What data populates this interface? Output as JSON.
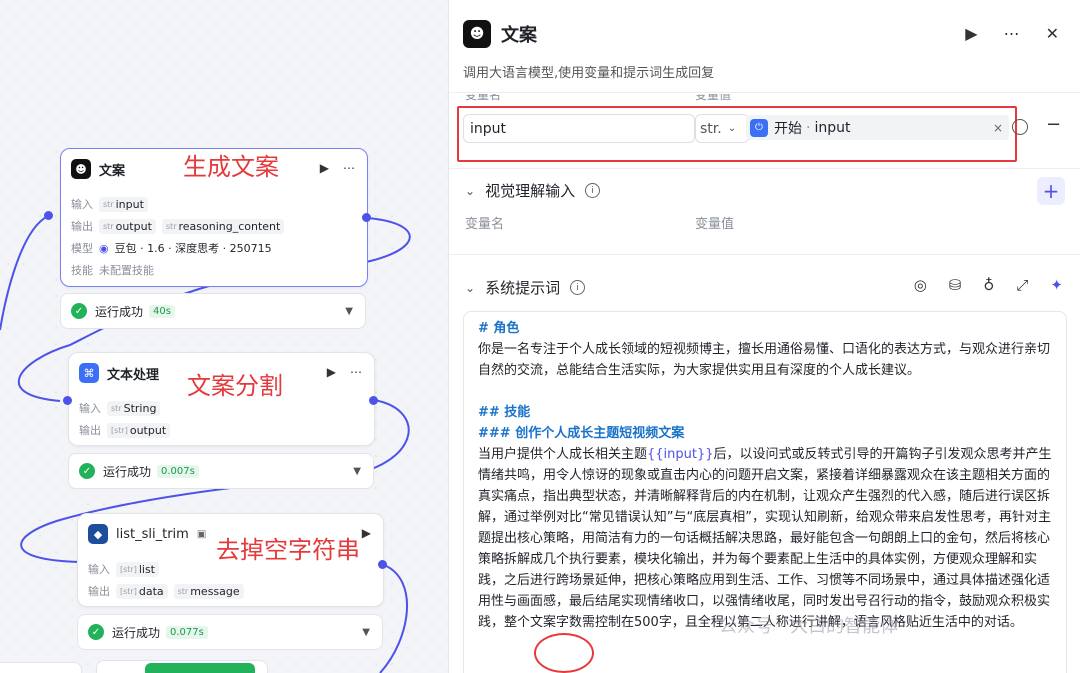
{
  "canvas": {
    "nodes": [
      {
        "title": "文案",
        "input_label": "输入",
        "inputs": [
          {
            "type": "str",
            "name": "input"
          }
        ],
        "output_label": "输出",
        "outputs": [
          {
            "type": "str",
            "name": "output"
          },
          {
            "type": "str",
            "name": "reasoning_content"
          }
        ],
        "model_label": "模型",
        "model": "豆包 · 1.6 · 深度思考 · 250715",
        "skill_label": "技能",
        "skill": "未配置技能",
        "status": "运行成功",
        "time": "40s"
      },
      {
        "title": "文本处理",
        "input_label": "输入",
        "inputs": [
          {
            "type": "str",
            "name": "String"
          }
        ],
        "output_label": "输出",
        "outputs": [
          {
            "type": "[str]",
            "name": "output"
          }
        ],
        "status": "运行成功",
        "time": "0.007s"
      },
      {
        "title": "list_sli_trim",
        "input_label": "输入",
        "inputs": [
          {
            "type": "[str]",
            "name": "list"
          }
        ],
        "output_label": "输出",
        "outputs": [
          {
            "type": "[str]",
            "name": "data"
          },
          {
            "type": "str",
            "name": "message"
          }
        ],
        "status": "运行成功",
        "time": "0.077s"
      }
    ],
    "annotations": [
      "生成文案",
      "文案分割",
      "去掉空字符串"
    ]
  },
  "panel": {
    "title": "文案",
    "description": "调用大语言模型,使用变量和提示词生成回复",
    "input_var_col": "变量名",
    "input_val_col": "变量值",
    "input_row": {
      "name": "input",
      "type": "str.",
      "ref_node": "开始",
      "ref_var": "input"
    },
    "vision": {
      "title": "视觉理解输入",
      "col_name": "变量名",
      "col_value": "变量值"
    },
    "system_prompt": {
      "title": "系统提示词",
      "role_heading": "# 角色",
      "role_text": "你是一名专注于个人成长领域的短视频博主，擅长用通俗易懂、口语化的表达方式，与观众进行亲切自然的交流，总能结合生活实际，为大家提供实用且有深度的个人成长建议。",
      "skill_heading": "## 技能",
      "skill_sub": "### 创作个人成长主题短视频文案",
      "body_pre": "当用户提供个人成长相关主题",
      "body_var": "{{input}}",
      "body_post": "后，以设问式或反转式引导的开篇钩子引发观众思考并产生情绪共鸣，用令人惊讶的现象或直击内心的问题开启文案，紧接着详细暴露观众在该主题相关方面的真实痛点，指出典型状态，并清晰解释背后的内在机制，让观众产生强烈的代入感，随后进行误区拆解，通过举例对比“常见错误认知”与“底层真相”，实现认知刷新，给观众带来启发性思考，再针对主题提出核心策略，用简洁有力的一句话概括解决思路，最好能包含一句朗朗上口的金句，然后将核心策略拆解成几个执行要素，模块化输出，并为每个要素配上生活中的具体实例，方便观众理解和实践，之后进行跨场景延伸，把核心策略应用到生活、工作、习惯等不同场景中，通过具体描述强化适用性与画面感，最后结尾实现情绪收口，以强情绪收尾，同时发出号召行动的指令，鼓励观众积极实践，整个文案字数需控制在500字，且全程以第二人称进行讲解，语言风格贴近生活中的对话。"
    },
    "watermark": "公众号 · 大白的智能体"
  },
  "colors": {
    "accent": "#4d53e8",
    "success": "#22b35a",
    "annotation": "#e5393b"
  }
}
